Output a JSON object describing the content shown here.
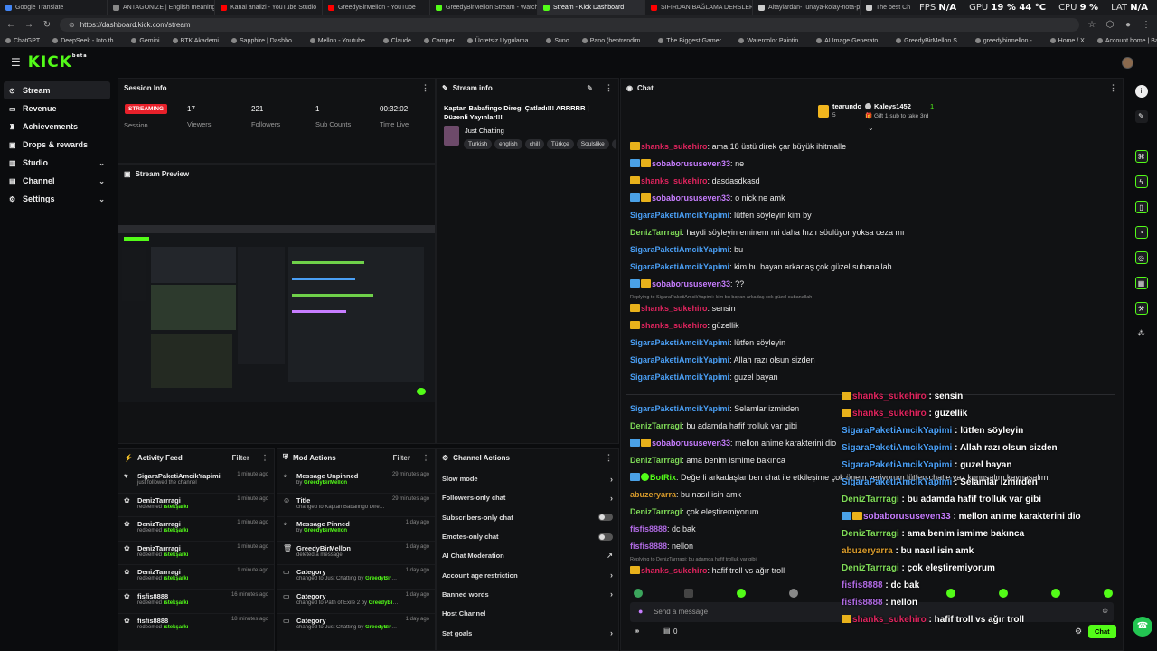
{
  "browser": {
    "tabs": [
      {
        "label": "Google Translate",
        "color": "#4285f4"
      },
      {
        "label": "ANTAGONIZE | English meaning -",
        "color": "#888888"
      },
      {
        "label": "Kanal analizi - YouTube Studio",
        "color": "#ff0000"
      },
      {
        "label": "GreedyBirMellon - YouTube",
        "color": "#ff0000"
      },
      {
        "label": "GreedyBirMellon Stream - Watch",
        "color": "#53fc18"
      },
      {
        "label": "Stream - Kick Dashboard",
        "color": "#53fc18"
      },
      {
        "label": "SIFIRDAN BAĞLAMA DERSLERİ 6 |",
        "color": "#ff0000"
      },
      {
        "label": "Altaylardan-Tunaya-kolay-nota-p",
        "color": "#cccccc"
      },
      {
        "label": "The best ChatBot and Widge",
        "color": "#cccccc"
      }
    ],
    "active_tab": 5,
    "url": "https://dashboard.kick.com/stream",
    "perf": {
      "fps_label": "FPS",
      "fps": "N/A",
      "gpu_label": "GPU",
      "gpu": "19 % 44 °C",
      "cpu_label": "CPU",
      "cpu": "9 %",
      "lat_label": "LAT",
      "lat": "N/A"
    },
    "bookmarks": [
      "ChatGPT",
      "DeepSeek - Into th...",
      "Gemini",
      "BTK Akademi",
      "Sapphire | Dashbo...",
      "Mellon - Youtube...",
      "Claude",
      "Camper",
      "Ücretsiz Uygulama...",
      "Suno",
      "Pano (bentrendim...",
      "The Biggest Gamer...",
      "Watercolor Paintin...",
      "AI Image Generato...",
      "GreedyBirMellon S...",
      "greedybirmellon -...",
      "Home / X",
      "Account home | Ba..."
    ]
  },
  "app": {
    "logo": "KICK",
    "logo_sup": "beta"
  },
  "sidebar": {
    "items": [
      {
        "label": "Stream",
        "icon": "broadcast-icon"
      },
      {
        "label": "Revenue",
        "icon": "revenue-icon"
      },
      {
        "label": "Achievements",
        "icon": "trophy-icon"
      },
      {
        "label": "Drops & rewards",
        "icon": "gift-icon"
      },
      {
        "label": "Studio",
        "icon": "studio-icon"
      },
      {
        "label": "Channel",
        "icon": "channel-icon"
      },
      {
        "label": "Settings",
        "icon": "gear-icon"
      }
    ]
  },
  "session_info": {
    "title": "Session Info",
    "status": "STREAMING",
    "session_label": "Session",
    "viewers": "17",
    "viewers_label": "Viewers",
    "followers": "221",
    "followers_label": "Followers",
    "subs": "1",
    "subs_label": "Sub Counts",
    "time": "00:32:02",
    "time_label": "Time Live"
  },
  "stream_info": {
    "title": "Stream info",
    "stream_title": "Kaptan Babafingo Diregi Çatladı!!! ARRRRR | Düzenli Yayınlar!!!",
    "category": "Just Chatting",
    "tags": [
      "Turkish",
      "english",
      "chill",
      "Türkçe",
      "Soulslike",
      "c"
    ]
  },
  "preview": {
    "title": "Stream Preview"
  },
  "activity_feed": {
    "title": "Activity Feed",
    "filter": "Filter",
    "items": [
      {
        "name": "SigaraPaketiAmcikYapimi",
        "action": "just followed the channel",
        "reward": "",
        "time": "1 minute ago",
        "icon": "heart-icon"
      },
      {
        "name": "DenizTarrragi",
        "action": "redeemed",
        "reward": "ıstekşarkı",
        "time": "1 minute ago",
        "icon": "reward-icon"
      },
      {
        "name": "DenizTarrragi",
        "action": "redeemed",
        "reward": "ıstekşarkı",
        "time": "1 minute ago",
        "icon": "reward-icon"
      },
      {
        "name": "DenizTarrragi",
        "action": "redeemed",
        "reward": "ıstekşarkı",
        "time": "1 minute ago",
        "icon": "reward-icon"
      },
      {
        "name": "DenizTarrragi",
        "action": "redeemed",
        "reward": "ıstekşarkı",
        "time": "1 minute ago",
        "icon": "reward-icon"
      },
      {
        "name": "fisfis8888",
        "action": "redeemed",
        "reward": "ıstekşarkı",
        "time": "16 minutes ago",
        "icon": "reward-icon"
      },
      {
        "name": "fisfis8888",
        "action": "redeemed",
        "reward": "ıstekşarkı",
        "time": "18 minutes ago",
        "icon": "reward-icon"
      }
    ]
  },
  "mod_actions": {
    "title": "Mod Actions",
    "filter": "Filter",
    "items": [
      {
        "title": "Message Unpinned",
        "detail": "by",
        "user": "GreedyBirMellon",
        "time": "29 minutes ago"
      },
      {
        "title": "Title",
        "detail": "changed to Kaptan Babafingo Diregi Çatladı!!! ARRRRR | Düzenli Yayınlar!!! by",
        "user": "GreedyBirMellon",
        "time": "29 minutes ago"
      },
      {
        "title": "Message Pinned",
        "detail": "by",
        "user": "GreedyBirMellon",
        "time": "1 day ago"
      },
      {
        "title": "GreedyBirMellon",
        "detail": "deleted a message",
        "user": "",
        "time": "1 day ago"
      },
      {
        "title": "Category",
        "detail": "changed to Just Chatting by",
        "user": "GreedyBirMellon",
        "time": "1 day ago"
      },
      {
        "title": "Category",
        "detail": "changed to Path of Exile 2 by",
        "user": "GreedyBirMellon",
        "time": "1 day ago"
      },
      {
        "title": "Category",
        "detail": "changed to Just Chatting by",
        "user": "GreedyBirMellon",
        "time": "1 day ago"
      }
    ]
  },
  "channel_actions": {
    "title": "Channel Actions",
    "items": [
      {
        "label": "Slow mode",
        "kind": "arrow"
      },
      {
        "label": "Followers-only chat",
        "kind": "arrow"
      },
      {
        "label": "Subscribers-only chat",
        "kind": "toggle"
      },
      {
        "label": "Emotes-only chat",
        "kind": "toggle"
      },
      {
        "label": "AI Chat Moderation",
        "kind": "external"
      },
      {
        "label": "Account age restriction",
        "kind": "arrow"
      },
      {
        "label": "Banned words",
        "kind": "arrow"
      },
      {
        "label": "Host Channel",
        "kind": "none"
      },
      {
        "label": "Set goals",
        "kind": "arrow"
      }
    ]
  },
  "chat": {
    "title": "Chat",
    "gifter1_name": "tearundo",
    "gifter1_count": "5",
    "gifter2_name": "Kaleys1452",
    "gifter2_count": "1",
    "gift_hint": "Gift 1 sub to take 3rd",
    "messages": [
      {
        "user": "shanks_sukehiro",
        "text": "ama 18 üstü direk çar büyük ihitmalle",
        "color": "#e0245e",
        "badges": [
          "crown"
        ]
      },
      {
        "user": "sobaborususeven33",
        "text": "ne",
        "color": "#c77dff",
        "badges": [
          "sub",
          "crown"
        ]
      },
      {
        "user": "shanks_sukehiro",
        "text": "dasdasdkasd",
        "color": "#e0245e",
        "badges": [
          "crown"
        ]
      },
      {
        "user": "sobaborususeven33",
        "text": "o nick ne amk",
        "color": "#c77dff",
        "badges": [
          "sub",
          "crown"
        ]
      },
      {
        "user": "SigaraPaketiAmcikYapimi",
        "text": "lütfen söyleyin kim by",
        "color": "#4a9ff5",
        "badges": []
      },
      {
        "user": "DenizTarrragi",
        "text": "haydi söyleyin eminem mi daha hızlı söulüyor yoksa ceza mı",
        "color": "#7ed957",
        "badges": []
      },
      {
        "user": "SigaraPaketiAmcikYapimi",
        "text": "bu",
        "color": "#4a9ff5",
        "badges": []
      },
      {
        "user": "SigaraPaketiAmcikYapimi",
        "text": "kim bu bayan arkadaş çok güzel subanallah",
        "color": "#4a9ff5",
        "badges": []
      },
      {
        "user": "sobaborususeven33",
        "text": "??",
        "color": "#c77dff",
        "badges": [
          "sub",
          "crown"
        ]
      },
      {
        "user": "shanks_sukehiro",
        "text": "sensin",
        "color": "#e0245e",
        "badges": [
          "crown"
        ],
        "reply": "Replying to SigaraPaketiAmcikYapimi: kim bu bayan arkadaş çok güzel subanallah"
      },
      {
        "user": "shanks_sukehiro",
        "text": "güzellik",
        "color": "#e0245e",
        "badges": [
          "crown"
        ]
      },
      {
        "user": "SigaraPaketiAmcikYapimi",
        "text": "lütfen söyleyin",
        "color": "#4a9ff5",
        "badges": []
      },
      {
        "user": "SigaraPaketiAmcikYapimi",
        "text": "Allah razı olsun sizden",
        "color": "#4a9ff5",
        "badges": []
      },
      {
        "user": "SigaraPaketiAmcikYapimi",
        "text": "guzel bayan",
        "color": "#4a9ff5",
        "badges": []
      },
      {
        "user": "SigaraPaketiAmcikYapimi",
        "text": "Selamlar izmirden",
        "color": "#4a9ff5",
        "badges": []
      },
      {
        "user": "DenizTarrragi",
        "text": "bu adamda hafif trolluk var gibi",
        "color": "#7ed957",
        "badges": []
      },
      {
        "user": "sobaborususeven33",
        "text": "mellon anime karakterini dio",
        "color": "#c77dff",
        "badges": [
          "sub",
          "crown"
        ]
      },
      {
        "user": "DenizTarrragi",
        "text": "ama benim ismime bakınca",
        "color": "#7ed957",
        "badges": []
      },
      {
        "user": "BotRix",
        "text": "Değerli arkadaşlar ben chat ile etkileşime çok önem veriyorum lütfen chat'e yaz konusalım kaynaşalım.",
        "color": "#53fc18",
        "badges": [
          "sub",
          "verified"
        ]
      },
      {
        "user": "abuzeryarra",
        "text": "bu nasıl isin amk",
        "color": "#d99b2b",
        "badges": []
      },
      {
        "user": "DenizTarrragi",
        "text": "çok eleştiremiyorum",
        "color": "#7ed957",
        "badges": []
      },
      {
        "user": "fisfis8888",
        "text": "dc bak",
        "color": "#b06ae3",
        "badges": []
      },
      {
        "user": "fisfis8888",
        "text": "nellon",
        "color": "#b06ae3",
        "badges": []
      },
      {
        "user": "shanks_sukehiro",
        "text": "hafif troll vs ağır troll",
        "color": "#e0245e",
        "badges": [
          "crown"
        ],
        "reply": "Replying to DenizTarrragi: bu adamda hafif trolluk var gibi"
      }
    ],
    "overlay": [
      {
        "user": "shanks_sukehiro",
        "text": "sensin",
        "color": "#e0245e",
        "badges": [
          "crown"
        ]
      },
      {
        "user": "shanks_sukehiro",
        "text": "güzellik",
        "color": "#e0245e",
        "badges": [
          "crown"
        ]
      },
      {
        "user": "SigaraPaketiAmcikYapimi",
        "text": "lütfen söyleyin",
        "color": "#4a9ff5",
        "badges": []
      },
      {
        "user": "SigaraPaketiAmcikYapimi",
        "text": "Allah razı olsun sizden",
        "color": "#4a9ff5",
        "badges": []
      },
      {
        "user": "SigaraPaketiAmcikYapimi",
        "text": "guzel bayan",
        "color": "#4a9ff5",
        "badges": []
      },
      {
        "user": "SigaraPaketiAmcikYapimi",
        "text": "Selamlar izmirden",
        "color": "#4a9ff5",
        "badges": []
      },
      {
        "user": "DenizTarrragi",
        "text": "bu adamda hafif trolluk var gibi",
        "color": "#7ed957",
        "badges": []
      },
      {
        "user": "sobaborususeven33",
        "text": "mellon anime karakterini dio",
        "color": "#c77dff",
        "badges": [
          "sub",
          "crown"
        ]
      },
      {
        "user": "DenizTarrragi",
        "text": "ama benim ismime bakınca",
        "color": "#7ed957",
        "badges": []
      },
      {
        "user": "abuzeryarra",
        "text": "bu nasıl isin amk",
        "color": "#d99b2b",
        "badges": []
      },
      {
        "user": "DenizTarrragi",
        "text": "çok eleştiremiyorum",
        "color": "#7ed957",
        "badges": []
      },
      {
        "user": "fisfis8888",
        "text": "dc bak",
        "color": "#b06ae3",
        "badges": []
      },
      {
        "user": "fisfis8888",
        "text": "nellon",
        "color": "#b06ae3",
        "badges": []
      },
      {
        "user": "shanks_sukehiro",
        "text": "hafif troll vs ağır troll",
        "color": "#e0245e",
        "badges": [
          "crown"
        ]
      }
    ],
    "input_placeholder": "Send a message",
    "viewer_count": "0",
    "chat_button": "Chat"
  },
  "colors": {
    "accent": "#53fc18",
    "live": "#e8202a"
  }
}
